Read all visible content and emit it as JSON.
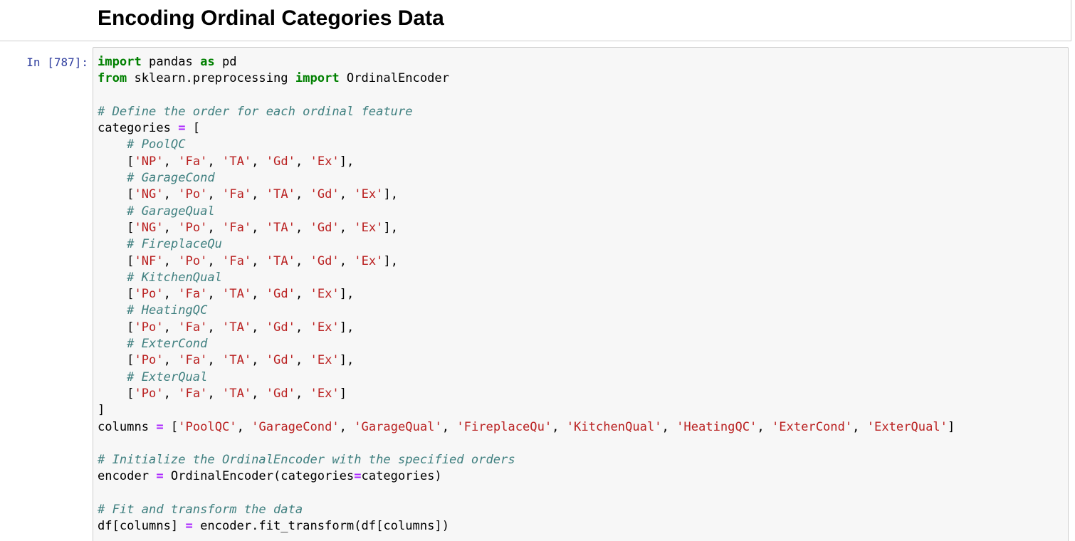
{
  "markdown": {
    "heading": "Encoding Ordinal Categories Data"
  },
  "code_cell": {
    "prompt": "In [787]:",
    "lines": [
      [
        [
          "kw",
          "import"
        ],
        [
          "plain",
          " pandas "
        ],
        [
          "kw",
          "as"
        ],
        [
          "plain",
          " pd"
        ]
      ],
      [
        [
          "kw",
          "from"
        ],
        [
          "plain",
          " sklearn.preprocessing "
        ],
        [
          "kw",
          "import"
        ],
        [
          "plain",
          " OrdinalEncoder"
        ]
      ],
      [],
      [
        [
          "com",
          "# Define the order for each ordinal feature"
        ]
      ],
      [
        [
          "plain",
          "categories "
        ],
        [
          "op",
          "="
        ],
        [
          "plain",
          " ["
        ]
      ],
      [
        [
          "plain",
          "    "
        ],
        [
          "com",
          "# PoolQC"
        ]
      ],
      [
        [
          "plain",
          "    ["
        ],
        [
          "str",
          "'NP'"
        ],
        [
          "plain",
          ", "
        ],
        [
          "str",
          "'Fa'"
        ],
        [
          "plain",
          ", "
        ],
        [
          "str",
          "'TA'"
        ],
        [
          "plain",
          ", "
        ],
        [
          "str",
          "'Gd'"
        ],
        [
          "plain",
          ", "
        ],
        [
          "str",
          "'Ex'"
        ],
        [
          "plain",
          "],"
        ]
      ],
      [
        [
          "plain",
          "    "
        ],
        [
          "com",
          "# GarageCond"
        ]
      ],
      [
        [
          "plain",
          "    ["
        ],
        [
          "str",
          "'NG'"
        ],
        [
          "plain",
          ", "
        ],
        [
          "str",
          "'Po'"
        ],
        [
          "plain",
          ", "
        ],
        [
          "str",
          "'Fa'"
        ],
        [
          "plain",
          ", "
        ],
        [
          "str",
          "'TA'"
        ],
        [
          "plain",
          ", "
        ],
        [
          "str",
          "'Gd'"
        ],
        [
          "plain",
          ", "
        ],
        [
          "str",
          "'Ex'"
        ],
        [
          "plain",
          "],"
        ]
      ],
      [
        [
          "plain",
          "    "
        ],
        [
          "com",
          "# GarageQual"
        ]
      ],
      [
        [
          "plain",
          "    ["
        ],
        [
          "str",
          "'NG'"
        ],
        [
          "plain",
          ", "
        ],
        [
          "str",
          "'Po'"
        ],
        [
          "plain",
          ", "
        ],
        [
          "str",
          "'Fa'"
        ],
        [
          "plain",
          ", "
        ],
        [
          "str",
          "'TA'"
        ],
        [
          "plain",
          ", "
        ],
        [
          "str",
          "'Gd'"
        ],
        [
          "plain",
          ", "
        ],
        [
          "str",
          "'Ex'"
        ],
        [
          "plain",
          "],"
        ]
      ],
      [
        [
          "plain",
          "    "
        ],
        [
          "com",
          "# FireplaceQu"
        ]
      ],
      [
        [
          "plain",
          "    ["
        ],
        [
          "str",
          "'NF'"
        ],
        [
          "plain",
          ", "
        ],
        [
          "str",
          "'Po'"
        ],
        [
          "plain",
          ", "
        ],
        [
          "str",
          "'Fa'"
        ],
        [
          "plain",
          ", "
        ],
        [
          "str",
          "'TA'"
        ],
        [
          "plain",
          ", "
        ],
        [
          "str",
          "'Gd'"
        ],
        [
          "plain",
          ", "
        ],
        [
          "str",
          "'Ex'"
        ],
        [
          "plain",
          "],"
        ]
      ],
      [
        [
          "plain",
          "    "
        ],
        [
          "com",
          "# KitchenQual"
        ]
      ],
      [
        [
          "plain",
          "    ["
        ],
        [
          "str",
          "'Po'"
        ],
        [
          "plain",
          ", "
        ],
        [
          "str",
          "'Fa'"
        ],
        [
          "plain",
          ", "
        ],
        [
          "str",
          "'TA'"
        ],
        [
          "plain",
          ", "
        ],
        [
          "str",
          "'Gd'"
        ],
        [
          "plain",
          ", "
        ],
        [
          "str",
          "'Ex'"
        ],
        [
          "plain",
          "],"
        ]
      ],
      [
        [
          "plain",
          "    "
        ],
        [
          "com",
          "# HeatingQC"
        ]
      ],
      [
        [
          "plain",
          "    ["
        ],
        [
          "str",
          "'Po'"
        ],
        [
          "plain",
          ", "
        ],
        [
          "str",
          "'Fa'"
        ],
        [
          "plain",
          ", "
        ],
        [
          "str",
          "'TA'"
        ],
        [
          "plain",
          ", "
        ],
        [
          "str",
          "'Gd'"
        ],
        [
          "plain",
          ", "
        ],
        [
          "str",
          "'Ex'"
        ],
        [
          "plain",
          "],"
        ]
      ],
      [
        [
          "plain",
          "    "
        ],
        [
          "com",
          "# ExterCond"
        ]
      ],
      [
        [
          "plain",
          "    ["
        ],
        [
          "str",
          "'Po'"
        ],
        [
          "plain",
          ", "
        ],
        [
          "str",
          "'Fa'"
        ],
        [
          "plain",
          ", "
        ],
        [
          "str",
          "'TA'"
        ],
        [
          "plain",
          ", "
        ],
        [
          "str",
          "'Gd'"
        ],
        [
          "plain",
          ", "
        ],
        [
          "str",
          "'Ex'"
        ],
        [
          "plain",
          "],"
        ]
      ],
      [
        [
          "plain",
          "    "
        ],
        [
          "com",
          "# ExterQual"
        ]
      ],
      [
        [
          "plain",
          "    ["
        ],
        [
          "str",
          "'Po'"
        ],
        [
          "plain",
          ", "
        ],
        [
          "str",
          "'Fa'"
        ],
        [
          "plain",
          ", "
        ],
        [
          "str",
          "'TA'"
        ],
        [
          "plain",
          ", "
        ],
        [
          "str",
          "'Gd'"
        ],
        [
          "plain",
          ", "
        ],
        [
          "str",
          "'Ex'"
        ],
        [
          "plain",
          "]"
        ]
      ],
      [
        [
          "plain",
          "]"
        ]
      ],
      [
        [
          "plain",
          "columns "
        ],
        [
          "op",
          "="
        ],
        [
          "plain",
          " ["
        ],
        [
          "str",
          "'PoolQC'"
        ],
        [
          "plain",
          ", "
        ],
        [
          "str",
          "'GarageCond'"
        ],
        [
          "plain",
          ", "
        ],
        [
          "str",
          "'GarageQual'"
        ],
        [
          "plain",
          ", "
        ],
        [
          "str",
          "'FireplaceQu'"
        ],
        [
          "plain",
          ", "
        ],
        [
          "str",
          "'KitchenQual'"
        ],
        [
          "plain",
          ", "
        ],
        [
          "str",
          "'HeatingQC'"
        ],
        [
          "plain",
          ", "
        ],
        [
          "str",
          "'ExterCond'"
        ],
        [
          "plain",
          ", "
        ],
        [
          "str",
          "'ExterQual'"
        ],
        [
          "plain",
          "]"
        ]
      ],
      [],
      [
        [
          "com",
          "# Initialize the OrdinalEncoder with the specified orders"
        ]
      ],
      [
        [
          "plain",
          "encoder "
        ],
        [
          "op",
          "="
        ],
        [
          "plain",
          " OrdinalEncoder(categories"
        ],
        [
          "op",
          "="
        ],
        [
          "plain",
          "categories)"
        ]
      ],
      [],
      [
        [
          "com",
          "# Fit and transform the data"
        ]
      ],
      [
        [
          "plain",
          "df[columns] "
        ],
        [
          "op",
          "="
        ],
        [
          "plain",
          " encoder.fit_transform(df[columns])"
        ]
      ]
    ]
  }
}
